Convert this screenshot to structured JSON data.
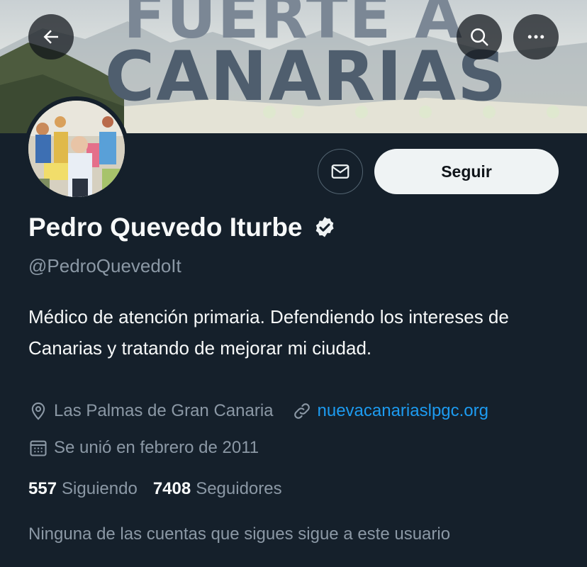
{
  "banner": {
    "line1": "FUERTE A",
    "line2": "CANARIAS"
  },
  "header": {
    "back_icon": "arrow-left-icon",
    "search_icon": "search-icon",
    "more_icon": "ellipsis-icon"
  },
  "profile": {
    "display_name": "Pedro Quevedo Iturbe",
    "verified": true,
    "handle": "@PedroQuevedoIt",
    "bio": "Médico de atención primaria. Defendiendo los intereses de Canarias y tratando de mejorar mi ciudad.",
    "location": "Las Palmas de Gran Canaria",
    "url": "nuevacanariaslpgc.org",
    "joined": "Se unió en febrero de 2011"
  },
  "actions": {
    "message_icon": "envelope-icon",
    "follow_label": "Seguir"
  },
  "stats": {
    "following_count": "557",
    "following_label": "Siguiendo",
    "followers_count": "7408",
    "followers_label": "Seguidores"
  },
  "followers_you_know": "Ninguna de las cuentas que sigues sigue a este usuario",
  "colors": {
    "background": "#15202b",
    "accent": "#1d9bf0",
    "secondary_text": "#8b98a5",
    "follow_button": "#eff3f4"
  }
}
